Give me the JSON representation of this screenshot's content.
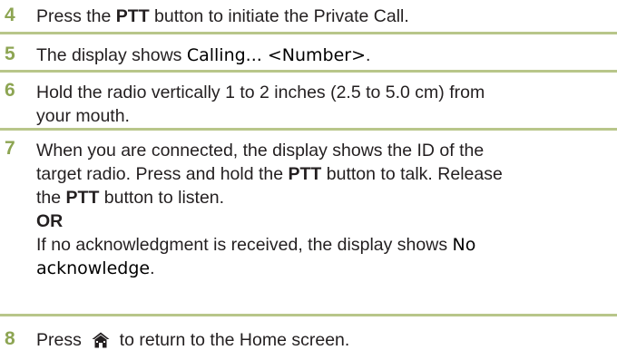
{
  "steps": [
    {
      "number": "4",
      "pre": "Press the ",
      "bold1": "PTT",
      "post": " button to initiate the Private Call."
    },
    {
      "number": "5",
      "pre": "The display shows ",
      "display": "Calling... <Number>",
      "post": "."
    },
    {
      "number": "6",
      "line1": "Hold the radio vertically 1 to 2 inches (2.5 to 5.0 cm) from",
      "line2": "your mouth."
    },
    {
      "number": "7",
      "line1": "When you are connected, the display shows the ID of the",
      "line2_pre": "target radio. Press and hold the ",
      "line2_bold": "PTT",
      "line2_post": " button to talk. Release",
      "line3_pre": "the ",
      "line3_bold": "PTT",
      "line3_post": " button to listen.",
      "or_label": "OR",
      "line5_pre": "If no acknowledgment is received, the display shows ",
      "display1": "No",
      "display2": "acknowledge",
      "line6_post": "."
    },
    {
      "number": "8",
      "pre": "Press ",
      "icon": "home-icon",
      "post": " to return to the Home screen."
    }
  ],
  "colors": {
    "step_number": "#8da553",
    "rule": "#b8c68a",
    "text": "#231f20"
  }
}
